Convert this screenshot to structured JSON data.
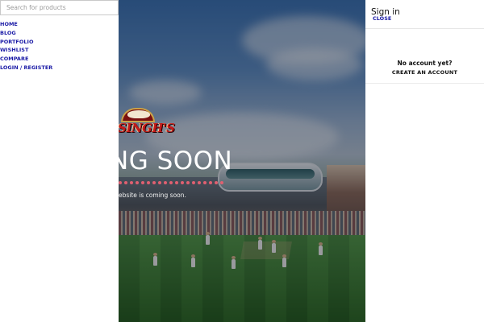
{
  "search": {
    "placeholder": "Search for products"
  },
  "menu": {
    "items": [
      {
        "label": "HOME"
      },
      {
        "label": "BLOG"
      },
      {
        "label": "PORTFOLIO"
      },
      {
        "label": "WISHLIST"
      },
      {
        "label": "COMPARE"
      },
      {
        "label": "LOGIN / REGISTER"
      }
    ]
  },
  "hero": {
    "logo_text": "SINGH'S",
    "title": "NG SOON",
    "subtitle": "ebsite is coming soon."
  },
  "signin": {
    "title": "Sign in",
    "close_label": "CLOSE",
    "no_account_text": "No account yet?",
    "create_account_label": "CREATE AN ACCOUNT"
  },
  "colors": {
    "link_blue": "#1a1aa6",
    "accent_dots": "#e06070",
    "logo_red": "#c41a1a"
  }
}
